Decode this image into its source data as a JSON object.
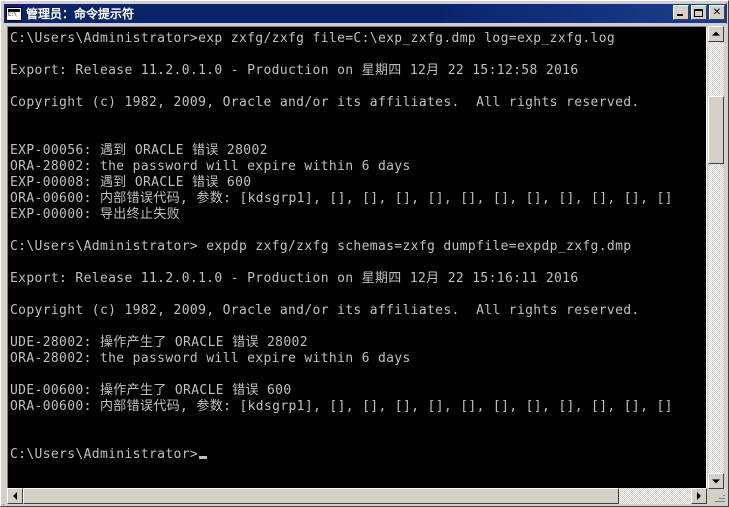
{
  "window": {
    "title": "管理员：命令提示符",
    "icon": "console-icon",
    "buttons": {
      "minimize_label": "_",
      "maximize_label": "□",
      "close_label": "✕"
    },
    "colors": {
      "titlebar": "#0a246a",
      "chrome": "#d4d0c8",
      "console_bg": "#000000",
      "console_fg": "#c0c0c0"
    }
  },
  "console": {
    "lines": [
      "C:\\Users\\Administrator>exp zxfg/zxfg file=C:\\exp_zxfg.dmp log=exp_zxfg.log",
      "",
      "Export: Release 11.2.0.1.0 - Production on 星期四 12月 22 15:12:58 2016",
      "",
      "Copyright (c) 1982, 2009, Oracle and/or its affiliates.  All rights reserved.",
      "",
      "",
      "EXP-00056: 遇到 ORACLE 错误 28002",
      "ORA-28002: the password will expire within 6 days",
      "EXP-00008: 遇到 ORACLE 错误 600",
      "ORA-00600: 内部错误代码, 参数: [kdsgrp1], [], [], [], [], [], [], [], [], [], [], []",
      "EXP-00000: 导出终止失败",
      "",
      "C:\\Users\\Administrator> expdp zxfg/zxfg schemas=zxfg dumpfile=expdp_zxfg.dmp",
      "",
      "Export: Release 11.2.0.1.0 - Production on 星期四 12月 22 15:16:11 2016",
      "",
      "Copyright (c) 1982, 2009, Oracle and/or its affiliates.  All rights reserved.",
      "",
      "UDE-28002: 操作产生了 ORACLE 错误 28002",
      "ORA-28002: the password will expire within 6 days",
      "",
      "UDE-00600: 操作产生了 ORACLE 错误 600",
      "ORA-00600: 内部错误代码, 参数: [kdsgrp1], [], [], [], [], [], [], [], [], [], [], []",
      "",
      "",
      "C:\\Users\\Administrator>"
    ],
    "prompt_cursor": "_"
  },
  "scrollbars": {
    "vertical": {
      "up_arrow": "▲",
      "down_arrow": "▼",
      "thumb_position_pct": 15
    },
    "horizontal": {
      "left_arrow": "◀",
      "right_arrow": "▶",
      "thumb_position_pct": 0
    }
  }
}
